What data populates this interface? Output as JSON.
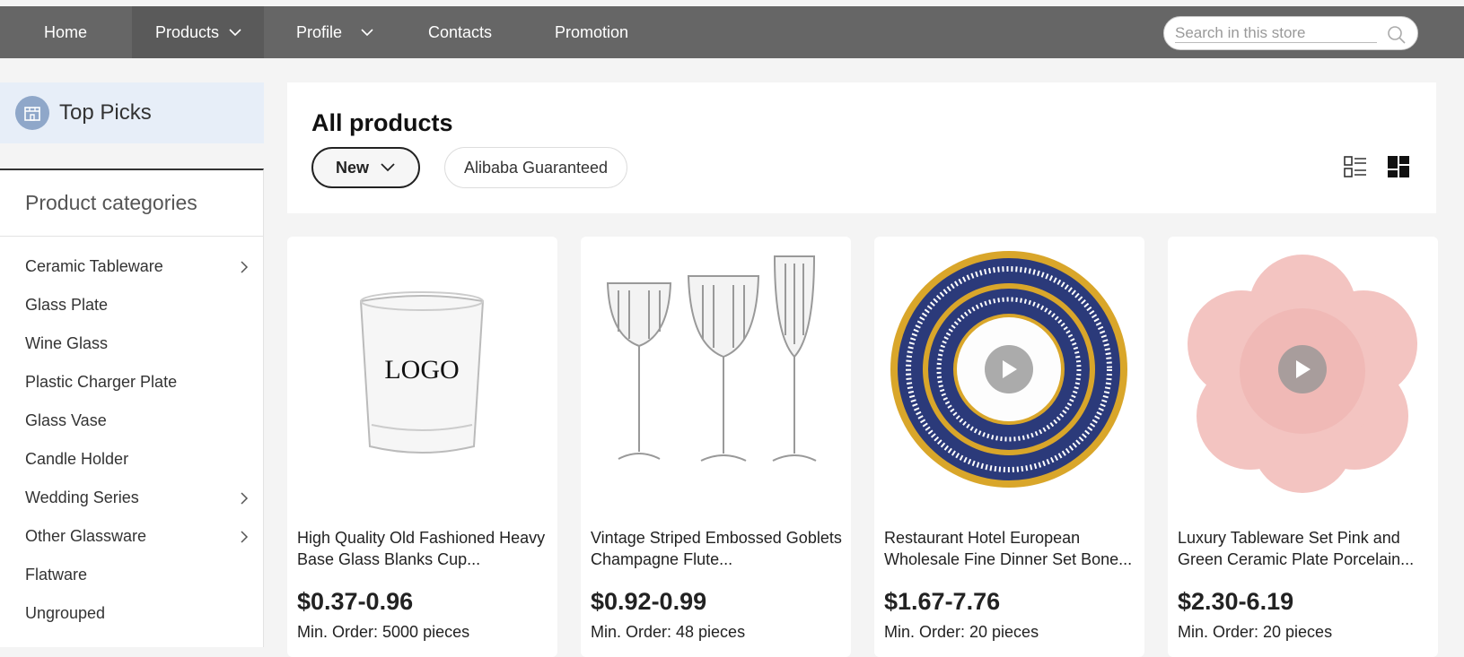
{
  "nav": {
    "items": [
      {
        "label": "Home",
        "has_dropdown": false
      },
      {
        "label": "Products",
        "has_dropdown": true
      },
      {
        "label": "Profile",
        "has_dropdown": true
      },
      {
        "label": "Contacts",
        "has_dropdown": false
      },
      {
        "label": "Promotion",
        "has_dropdown": false
      }
    ],
    "search_placeholder": "Search in this store"
  },
  "sidebar": {
    "top_picks_label": "Top Picks",
    "categories_title": "Product categories",
    "categories": [
      {
        "label": "Ceramic Tableware",
        "has_children": true
      },
      {
        "label": "Glass Plate",
        "has_children": false
      },
      {
        "label": "Wine Glass",
        "has_children": false
      },
      {
        "label": "Plastic Charger Plate",
        "has_children": false
      },
      {
        "label": "Glass Vase",
        "has_children": false
      },
      {
        "label": "Candle Holder",
        "has_children": false
      },
      {
        "label": "Wedding Series",
        "has_children": true
      },
      {
        "label": "Other Glassware",
        "has_children": true
      },
      {
        "label": "Flatware",
        "has_children": false
      },
      {
        "label": "Ungrouped",
        "has_children": false
      }
    ]
  },
  "main": {
    "title": "All products",
    "sort_label": "New",
    "filter_label": "Alibaba Guaranteed"
  },
  "products": [
    {
      "name": "High Quality Old Fashioned Heavy Base Glass Blanks Cup...",
      "price": "$0.37-0.96",
      "min_order": "Min. Order: 5000 pieces",
      "image_text": "LOGO",
      "has_video": false
    },
    {
      "name": "Vintage Striped Embossed Goblets Champagne Flute...",
      "price": "$0.92-0.99",
      "min_order": "Min. Order: 48 pieces",
      "has_video": false
    },
    {
      "name": "Restaurant Hotel European Wholesale Fine Dinner Set Bone...",
      "price": "$1.67-7.76",
      "min_order": "Min. Order: 20 pieces",
      "has_video": true
    },
    {
      "name": "Luxury Tableware Set Pink and Green Ceramic Plate Porcelain...",
      "price": "$2.30-6.19",
      "min_order": "Min. Order: 20 pieces",
      "has_video": true
    }
  ],
  "colors": {
    "nav_bg": "#666666",
    "accent_blue": "#e7eef8",
    "gold": "#d9a62a",
    "navy": "#2b3a7a",
    "pink": "#f3c4c1"
  }
}
